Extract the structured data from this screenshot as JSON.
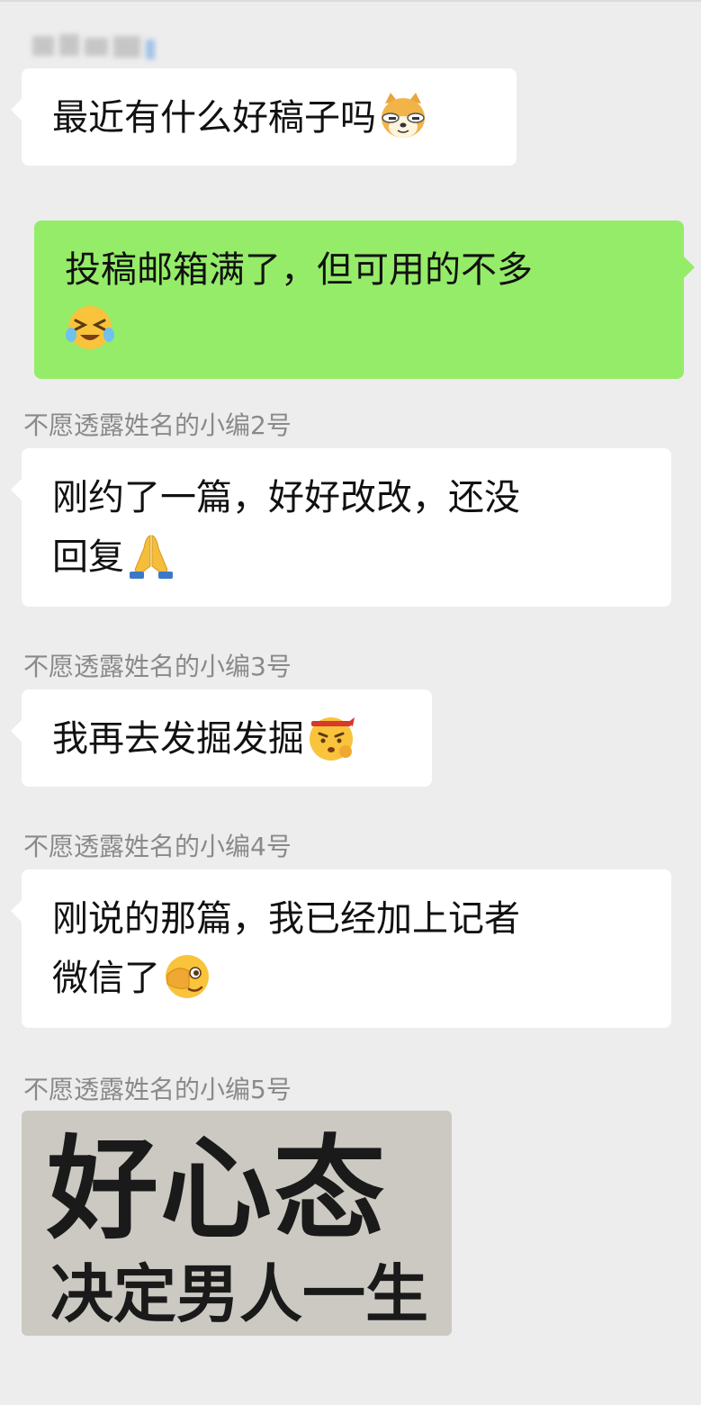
{
  "messages": [
    {
      "side": "left",
      "lines": [
        "最近有什么好稿子吗"
      ],
      "emoji": "doge-dog-face-icon"
    },
    {
      "side": "right",
      "lines": [
        "投稿邮箱满了，但可用的不多",
        ""
      ],
      "emoji": "crying-laughing-face-icon"
    },
    {
      "side": "left",
      "sender": "不愿透露姓名的小编2号",
      "lines": [
        "刚约了一篇，好好改改，还没",
        "回复"
      ],
      "emoji": "folded-hands-icon"
    },
    {
      "side": "left",
      "sender": "不愿透露姓名的小编3号",
      "lines": [
        "我再去发掘发掘"
      ],
      "emoji": "determined-face-with-headband-icon"
    },
    {
      "side": "left",
      "sender": "不愿透露姓名的小编4号",
      "lines": [
        "刚说的那篇，我已经加上记者",
        "微信了"
      ],
      "emoji": "peeking-face-icon"
    },
    {
      "side": "left",
      "sender": "不愿透露姓名的小编5号",
      "image": {
        "line1": "好心态",
        "line2": "决定男人一生"
      }
    }
  ],
  "colors": {
    "background": "#ededed",
    "bubble_incoming": "#ffffff",
    "bubble_outgoing": "#95ec69",
    "sender_text": "#8a8a8a",
    "message_text": "#111111"
  }
}
